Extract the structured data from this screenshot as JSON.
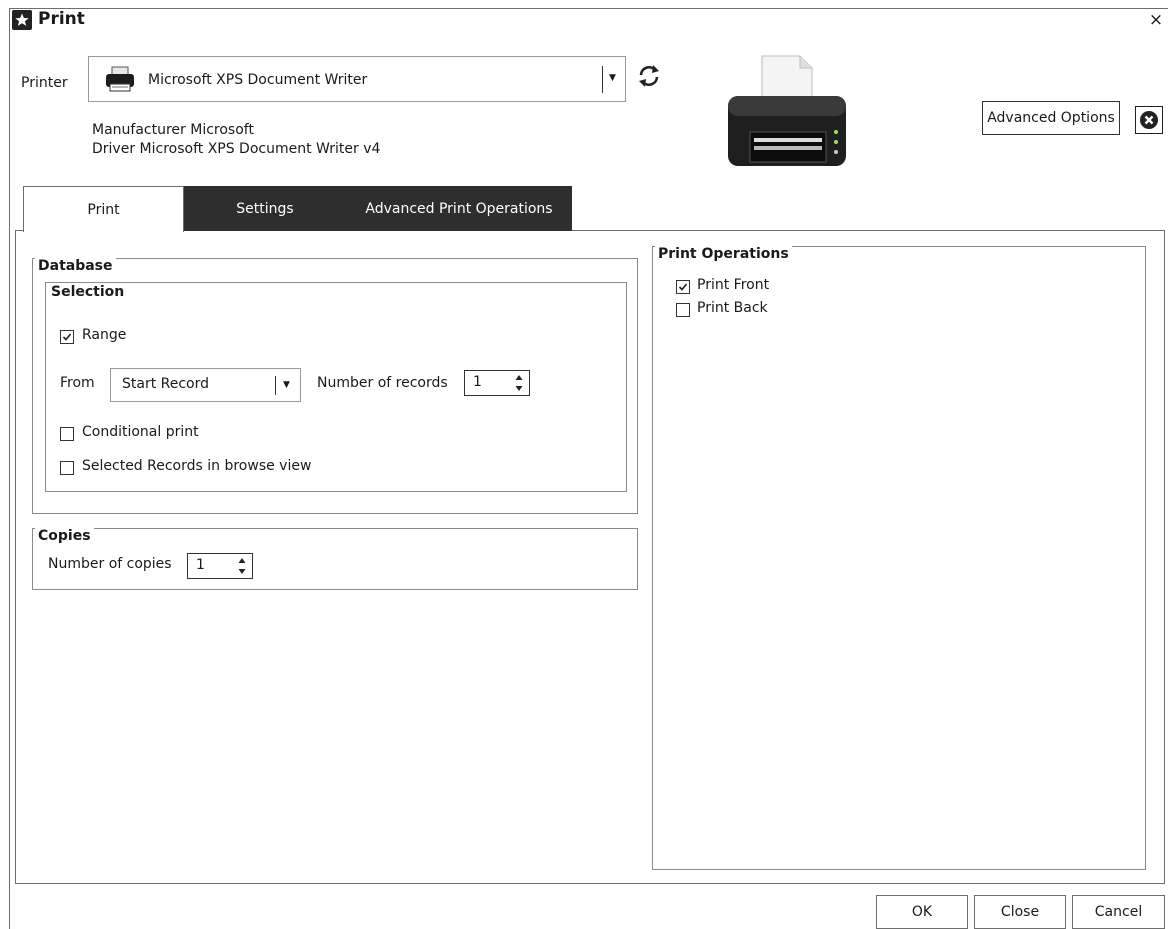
{
  "window": {
    "title": "Print",
    "close_glyph": "×"
  },
  "printer": {
    "label": "Printer",
    "selected": "Microsoft XPS Document Writer",
    "manufacturer": "Manufacturer Microsoft",
    "driver": "Driver Microsoft XPS Document Writer v4"
  },
  "advanced_options_label": "Advanced Options",
  "tabs": [
    {
      "label": "Print",
      "active": true
    },
    {
      "label": "Settings",
      "active": false
    },
    {
      "label": "Advanced Print Operations",
      "active": false
    }
  ],
  "database": {
    "title": "Database",
    "selection": {
      "title": "Selection",
      "range_label": "Range",
      "range_checked": true,
      "from_label": "From",
      "from_value": "Start Record",
      "num_records_label": "Number of records",
      "num_records_value": "1",
      "conditional_label": "Conditional print",
      "conditional_checked": false,
      "selected_records_label": "Selected Records in browse view",
      "selected_records_checked": false
    }
  },
  "copies": {
    "title": "Copies",
    "label": "Number of copies",
    "value": "1"
  },
  "print_operations": {
    "title": "Print Operations",
    "items": [
      {
        "label": "Print Front",
        "checked": true
      },
      {
        "label": "Print Back",
        "checked": false
      }
    ]
  },
  "footer": {
    "ok": "OK",
    "close": "Close",
    "cancel": "Cancel"
  }
}
